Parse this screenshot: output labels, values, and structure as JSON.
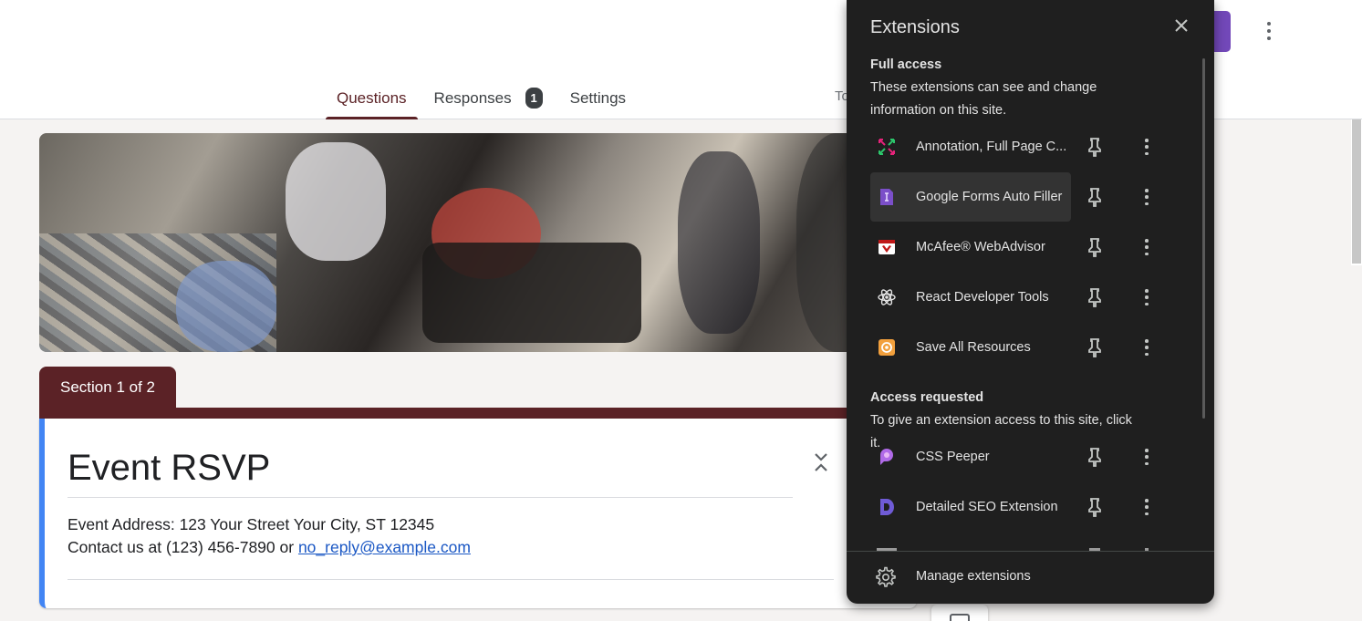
{
  "tabs": [
    {
      "label": "Questions",
      "active": true
    },
    {
      "label": "Responses",
      "badge": "1"
    },
    {
      "label": "Settings"
    }
  ],
  "header": {
    "total_peek": "To"
  },
  "section": {
    "label": "Section 1 of 2"
  },
  "form": {
    "title": "Event RSVP",
    "address": "Event Address: 123 Your Street Your City, ST 12345",
    "contact_prefix": "Contact us at (123) 456-7890 or ",
    "contact_email": "no_reply@example.com"
  },
  "extensions": {
    "title": "Extensions",
    "full_access": {
      "heading": "Full access",
      "description": "These extensions can see and change information on this site.",
      "items": [
        {
          "name": "Annotation, Full Page C...",
          "icon": "annotation-icon",
          "color": "#e6237a"
        },
        {
          "name": "Google Forms Auto Filler",
          "icon": "forms-auto-filler-icon",
          "color": "#7b4fc9"
        },
        {
          "name": "McAfee® WebAdvisor",
          "icon": "mcafee-icon",
          "color": "#c01818"
        },
        {
          "name": "React Developer Tools",
          "icon": "react-icon",
          "color": "#e3e3e3"
        },
        {
          "name": "Save All Resources",
          "icon": "save-resources-icon",
          "color": "#f2a03d"
        }
      ]
    },
    "access_requested": {
      "heading": "Access requested",
      "description": "To give an extension access to this site, click it.",
      "items": [
        {
          "name": "CSS Peeper",
          "icon": "css-peeper-icon",
          "color": "#b06ae8"
        },
        {
          "name": "Detailed SEO Extension",
          "icon": "detailed-seo-icon",
          "color": "#6f5bd6"
        }
      ]
    },
    "manage_label": "Manage extensions"
  }
}
